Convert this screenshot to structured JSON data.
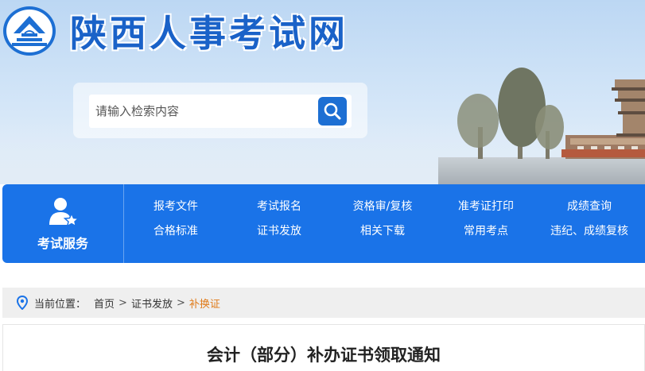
{
  "site": {
    "title": "陕西人事考试网",
    "brand_color": "#1a62c8"
  },
  "search": {
    "placeholder": "请输入检索内容",
    "button_icon": "search-icon"
  },
  "service": {
    "heading": "考试服务",
    "heading_icon": "user-star-icon",
    "background": "#1a73e8",
    "links": [
      "报考文件",
      "考试报名",
      "资格审/复核",
      "准考证打印",
      "成绩查询",
      "合格标准",
      "证书发放",
      "相关下载",
      "常用考点",
      "违纪、成绩复核"
    ]
  },
  "breadcrumb": {
    "icon": "location-pin-icon",
    "prefix": "当前位置：",
    "home": "首页",
    "section": "证书发放",
    "current": "补换证",
    "separator": ">",
    "current_color": "#e07b1a"
  },
  "article": {
    "title": "会计（部分）补办证书领取通知"
  }
}
